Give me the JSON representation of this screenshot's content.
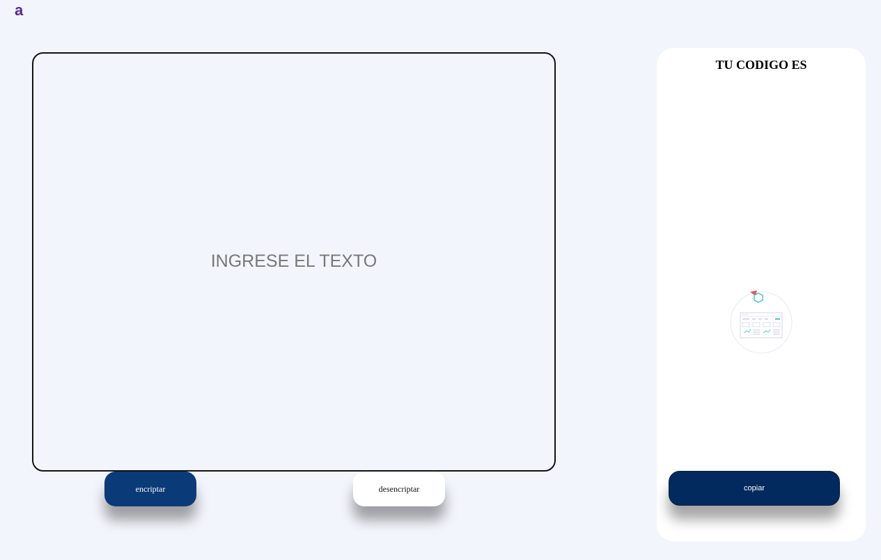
{
  "header": {
    "logo_text": "a"
  },
  "input": {
    "placeholder": "INGRESE EL TEXTO",
    "value": ""
  },
  "buttons": {
    "encrypt_label": "encriptar",
    "decrypt_label": "desencriptar"
  },
  "output": {
    "title": "TU CODIGO ES",
    "illustration_icon": "dashboard-illustration-icon",
    "copy_label": "copiar"
  },
  "colors": {
    "background": "#f3f5fc",
    "logo": "#5b2a86",
    "encrypt_button": "#0b3a78",
    "copy_button": "#022a5e"
  }
}
